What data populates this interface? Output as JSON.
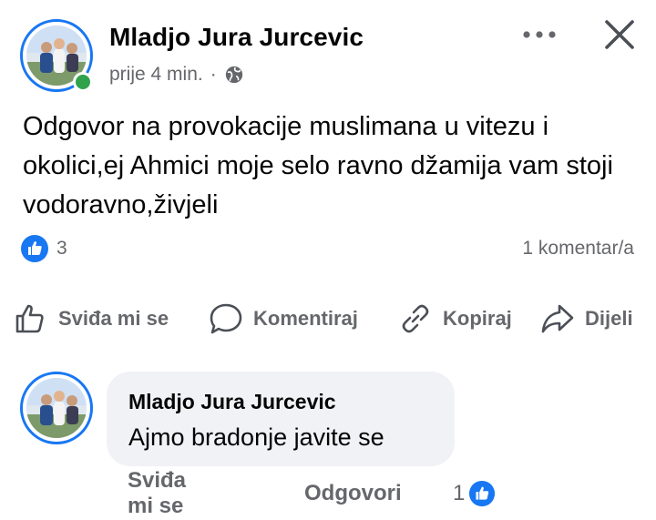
{
  "post": {
    "author": "Mladjo Jura Jurcevic",
    "time": "prije 4 min.",
    "separator": "·",
    "privacy_icon": "globe-icon",
    "text": "Odgovor na provokacije muslimana u vitezu i okolici,ej Ahmici moje selo ravno džamija vam stoji vodoravno,živjeli",
    "reaction_count": "3",
    "comment_count": "1 komentar/a",
    "online_status_color": "#31a24c"
  },
  "header_actions": {
    "more_icon": "more-horizontal-icon",
    "close_icon": "close-icon"
  },
  "actions": {
    "like": "Sviđa mi se",
    "comment": "Komentiraj",
    "copy": "Kopiraj",
    "share": "Dijeli"
  },
  "comment": {
    "author": "Mladjo Jura Jurcevic",
    "text": "Ajmo bradonje javite se",
    "like": "Sviđa mi se",
    "reply": "Odgovori",
    "reaction_count": "1"
  },
  "colors": {
    "accent": "#1877f2",
    "secondary_text": "#65676b",
    "bubble": "#f0f2f5"
  }
}
